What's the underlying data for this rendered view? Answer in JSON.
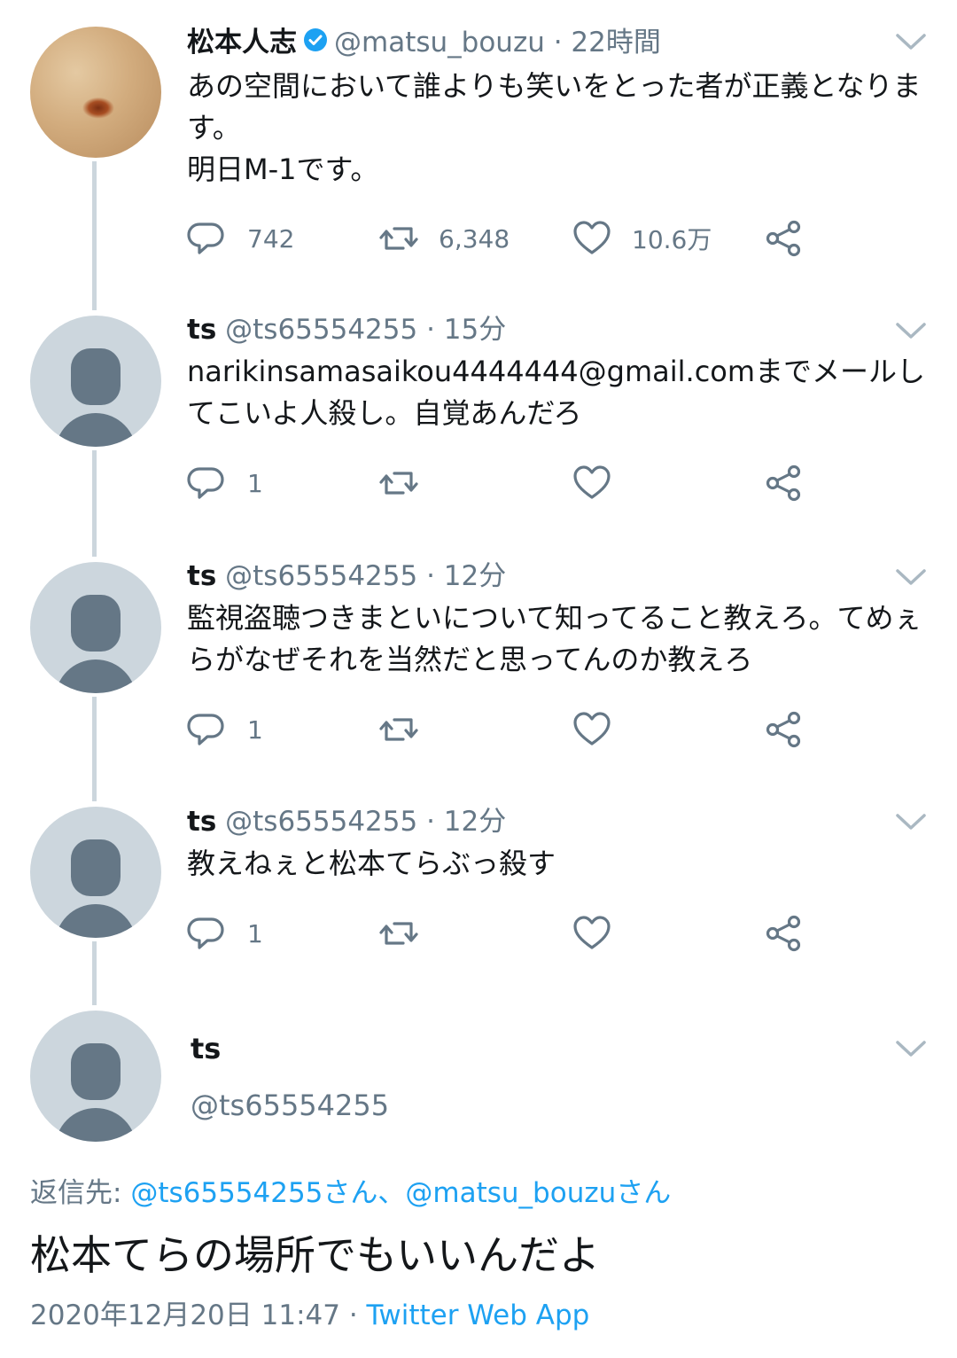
{
  "tweets": [
    {
      "name": "松本人志",
      "verified": true,
      "handle": "@matsu_bouzu",
      "time": "22時間",
      "text": "あの空間において誰よりも笑いをとった者が正義となります。\n明日M-1です。",
      "replies": "742",
      "retweets": "6,348",
      "likes": "10.6万"
    },
    {
      "name": "ts",
      "handle": "@ts65554255",
      "time": "15分",
      "text": "narikinsamasaikou4444444@gmail.comまでメールしてこいよ人殺し。自覚あんだろ",
      "replies": "1",
      "retweets": "",
      "likes": ""
    },
    {
      "name": "ts",
      "handle": "@ts65554255",
      "time": "12分",
      "text": "監視盗聴つきまといについて知ってること教えろ。てめぇらがなぜそれを当然だと思ってんのか教えろ",
      "replies": "1",
      "retweets": "",
      "likes": ""
    },
    {
      "name": "ts",
      "handle": "@ts65554255",
      "time": "12分",
      "text": "教えねぇと松本てらぶっ殺す",
      "replies": "1",
      "retweets": "",
      "likes": ""
    }
  ],
  "focused": {
    "name": "ts",
    "handle": "@ts65554255",
    "reply_to_label": "返信先:",
    "reply_to_1": "@ts65554255さん",
    "reply_to_sep": "、",
    "reply_to_2": "@matsu_bouzuさん",
    "text": "松本てらの場所でもいいんだよ",
    "timestamp": "2020年12月20日 11:47",
    "meta_sep": " · ",
    "client": "Twitter Web App"
  },
  "separator": " · ",
  "colors": {
    "accent": "#1da1f2",
    "muted": "#657786",
    "line": "#ccd6dd"
  }
}
